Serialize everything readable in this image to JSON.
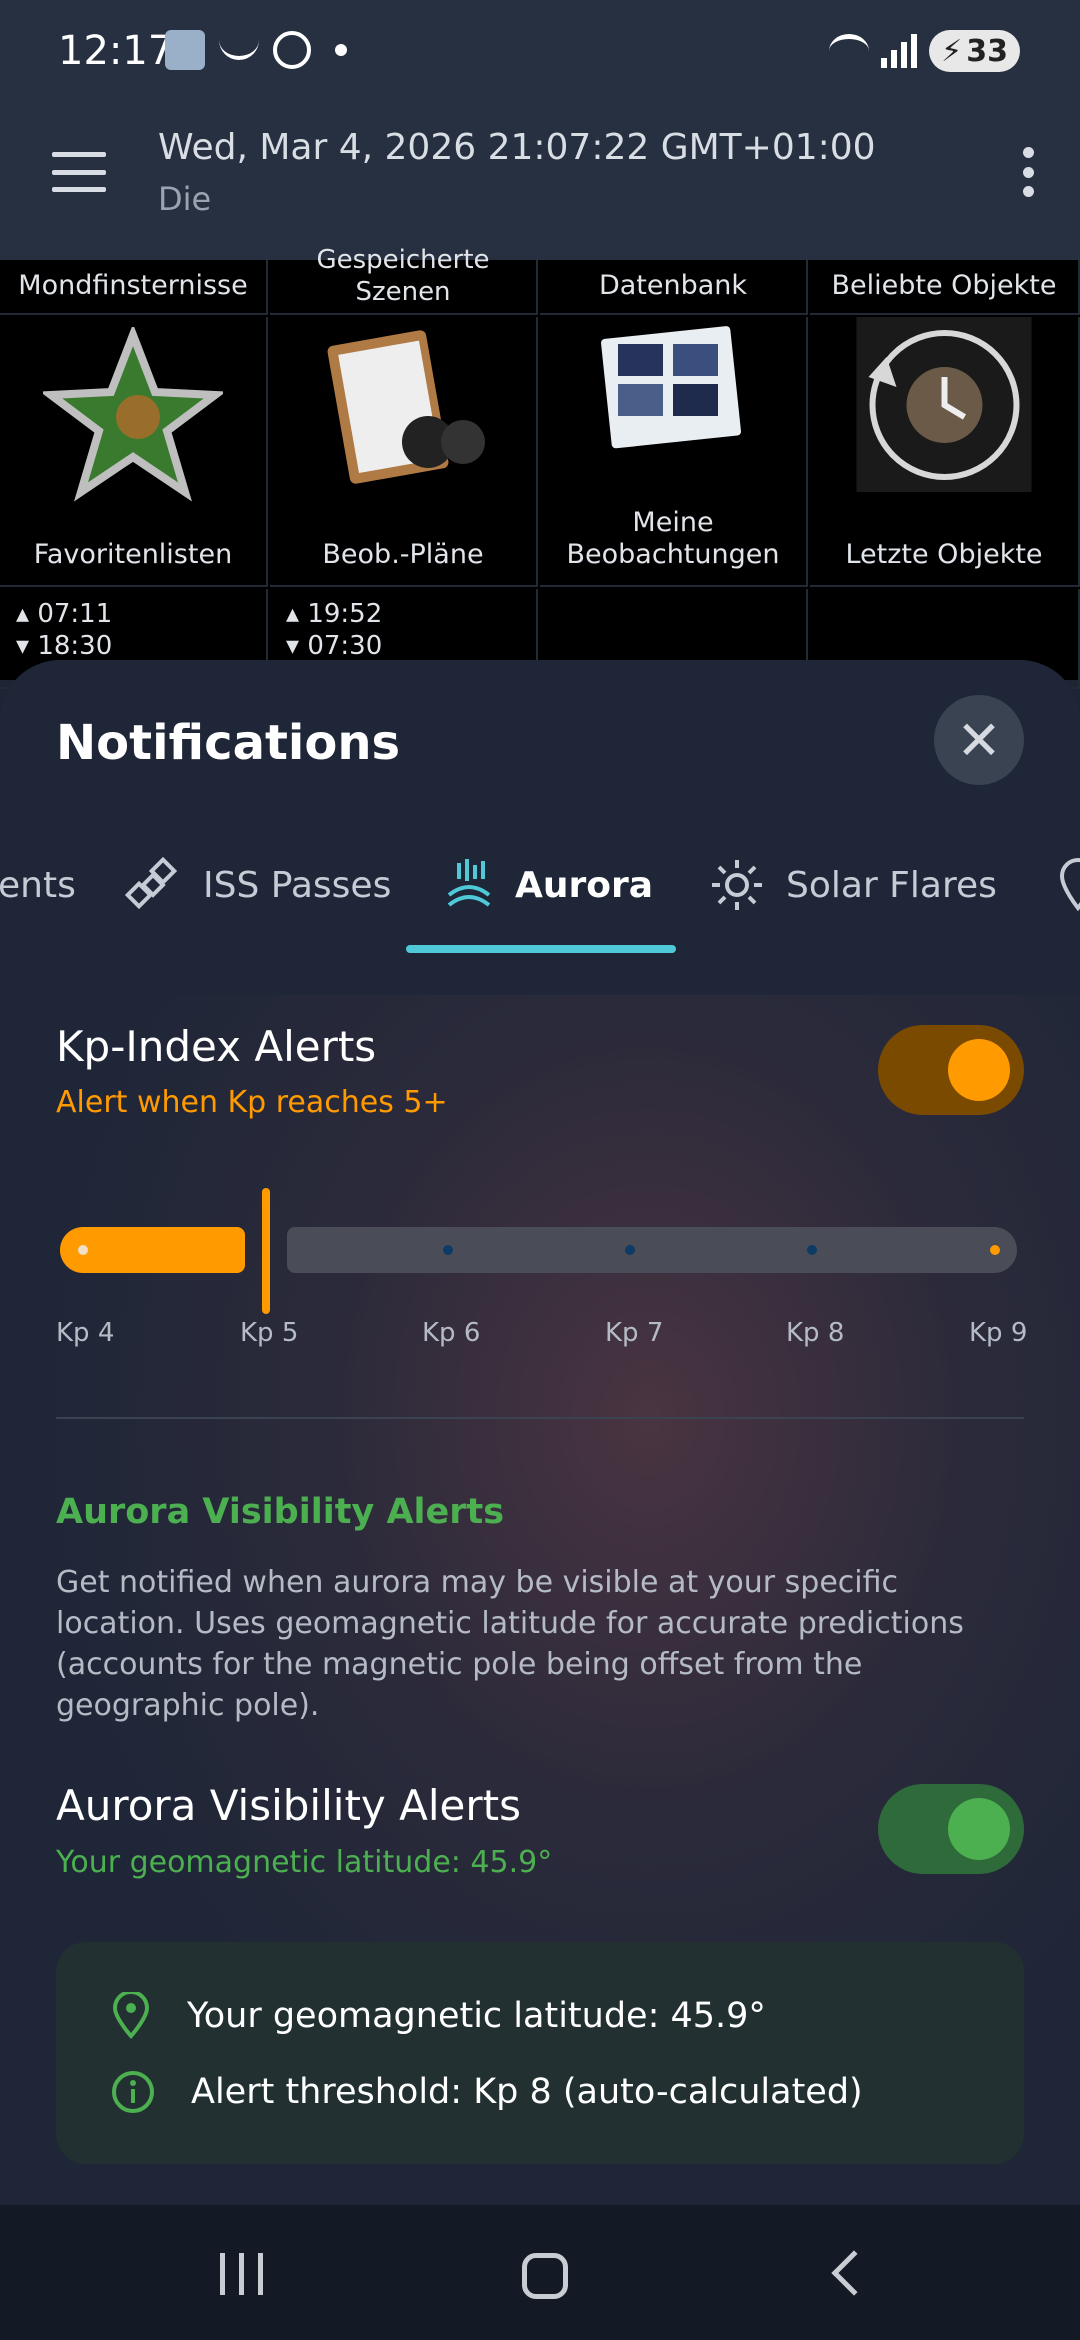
{
  "status_bar": {
    "time": "12:17",
    "battery": "33"
  },
  "app_bar": {
    "title": "Wed, Mar 4, 2026 21:07:22 GMT+01:00",
    "subtitle": "Die"
  },
  "grid": {
    "top_labels": [
      "Mondfinsternisse",
      "Gespeicherte Szenen",
      "Datenbank",
      "Beliebte Objekte"
    ],
    "items": [
      "Favoritenlisten",
      "Beob.-Pläne",
      "Meine Beobachtungen",
      "Letzte Objekte"
    ],
    "times": [
      {
        "rise": "07:11",
        "set": "18:30"
      },
      {
        "rise": "19:52",
        "set": "07:30"
      }
    ]
  },
  "sheet": {
    "title": "Notifications",
    "tabs": [
      "ents",
      "ISS Passes",
      "Aurora",
      "Solar Flares"
    ],
    "active_tab": "Aurora"
  },
  "kp_alerts": {
    "title": "Kp-Index Alerts",
    "subtitle": "Alert when Kp reaches 5+",
    "enabled": true,
    "threshold": 5,
    "labels": [
      "Kp 4",
      "Kp 5",
      "Kp 6",
      "Kp 7",
      "Kp 8",
      "Kp 9"
    ]
  },
  "aurora_visibility": {
    "heading": "Aurora Visibility Alerts",
    "description": "Get notified when aurora may be visible at your specific location. Uses geomagnetic latitude for accurate predictions (accounts for the magnetic pole being offset from the geographic pole).",
    "title": "Aurora Visibility Alerts",
    "subtitle": "Your geomagnetic latitude: 45.9°",
    "enabled": true,
    "info_latitude": "Your geomagnetic latitude: 45.9°",
    "info_threshold": "Alert threshold: Kp 8 (auto-calculated)"
  },
  "colors": {
    "accent_orange": "#ff9a00",
    "accent_green": "#4caf50",
    "tab_underline": "#4fc9d8"
  }
}
